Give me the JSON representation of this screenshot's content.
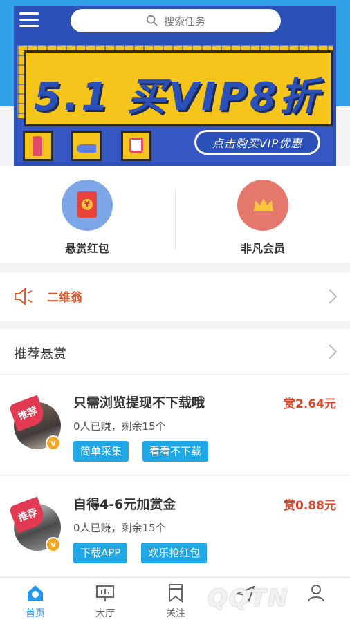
{
  "search": {
    "placeholder": "搜索任务"
  },
  "banner": {
    "headline": "5.1 买VIP8折",
    "cta": "点击购买VIP优惠",
    "brand_color": "#2b50b8",
    "bg_color": "#f6c51b"
  },
  "quick_actions": [
    {
      "label": "悬赏红包",
      "icon": "red-envelope-icon"
    },
    {
      "label": "非凡会员",
      "icon": "crown-icon"
    }
  ],
  "notice": {
    "text": "二维翁",
    "icon": "speaker-icon"
  },
  "section": {
    "title": "推荐悬赏"
  },
  "tasks": [
    {
      "badge": "推荐",
      "title": "只需浏览提现不下载哦",
      "reward": "赏2.64元",
      "meta": "0人已赚，剩余15个",
      "tags": [
        "简单采集",
        "看看不下载"
      ]
    },
    {
      "badge": "推荐",
      "title": "自得4-6元加赏金",
      "reward": "赏0.88元",
      "meta": "0人已赚，剩余15个",
      "tags": [
        "下载APP",
        "欢乐抢红包"
      ]
    }
  ],
  "tabbar": [
    {
      "label": "首页",
      "icon": "home-icon",
      "active": true
    },
    {
      "label": "大厅",
      "icon": "hall-icon",
      "active": false
    },
    {
      "label": "关注",
      "icon": "bookmark-icon",
      "active": false
    },
    {
      "label": "",
      "icon": "plane-icon",
      "active": false
    },
    {
      "label": "",
      "icon": "user-icon",
      "active": false
    }
  ],
  "watermark": "QQTN",
  "colors": {
    "accent": "#2196f3",
    "reward": "#e0462b",
    "tag": "#1fa7e6"
  }
}
